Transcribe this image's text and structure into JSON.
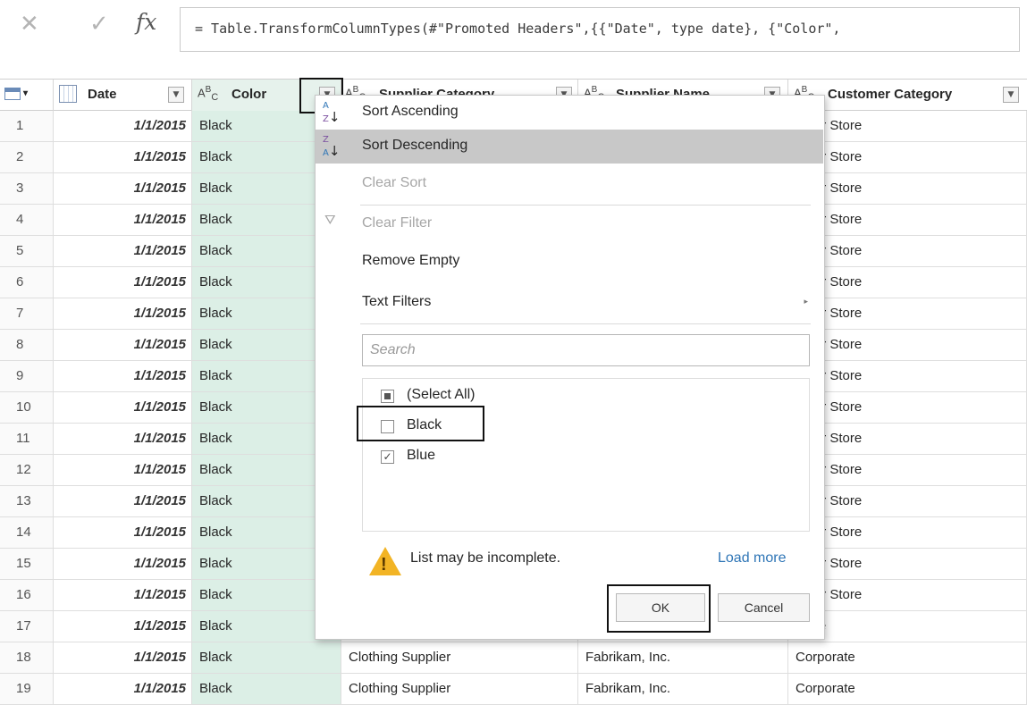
{
  "formula_bar": {
    "cancel_icon": "close-icon",
    "commit_icon": "check-icon",
    "fx_label": "fx",
    "formula": "= Table.TransformColumnTypes(#\"Promoted Headers\",{{\"Date\", type date}, {\"Color\","
  },
  "headers": {
    "date": "Date",
    "color": "Color",
    "supplier_category": "Supplier Category",
    "supplier_name": "Supplier Name",
    "customer_category": "Customer Category",
    "type_text": "A",
    "type_sup": "B",
    "type_sub": "C"
  },
  "rows": [
    {
      "n": "1",
      "date": "1/1/2015",
      "color": "Black",
      "customer_category": "puter Store"
    },
    {
      "n": "2",
      "date": "1/1/2015",
      "color": "Black",
      "customer_category": "puter Store"
    },
    {
      "n": "3",
      "date": "1/1/2015",
      "color": "Black",
      "customer_category": "puter Store"
    },
    {
      "n": "4",
      "date": "1/1/2015",
      "color": "Black",
      "customer_category": "puter Store"
    },
    {
      "n": "5",
      "date": "1/1/2015",
      "color": "Black",
      "customer_category": "puter Store"
    },
    {
      "n": "6",
      "date": "1/1/2015",
      "color": "Black",
      "customer_category": "puter Store"
    },
    {
      "n": "7",
      "date": "1/1/2015",
      "color": "Black",
      "customer_category": "puter Store"
    },
    {
      "n": "8",
      "date": "1/1/2015",
      "color": "Black",
      "customer_category": "puter Store"
    },
    {
      "n": "9",
      "date": "1/1/2015",
      "color": "Black",
      "customer_category": "puter Store"
    },
    {
      "n": "10",
      "date": "1/1/2015",
      "color": "Black",
      "customer_category": "puter Store"
    },
    {
      "n": "11",
      "date": "1/1/2015",
      "color": "Black",
      "customer_category": "puter Store"
    },
    {
      "n": "12",
      "date": "1/1/2015",
      "color": "Black",
      "customer_category": "puter Store"
    },
    {
      "n": "13",
      "date": "1/1/2015",
      "color": "Black",
      "customer_category": "puter Store"
    },
    {
      "n": "14",
      "date": "1/1/2015",
      "color": "Black",
      "customer_category": "puter Store"
    },
    {
      "n": "15",
      "date": "1/1/2015",
      "color": "Black",
      "customer_category": "puter Store"
    },
    {
      "n": "16",
      "date": "1/1/2015",
      "color": "Black",
      "customer_category": "puter Store"
    },
    {
      "n": "17",
      "date": "1/1/2015",
      "color": "Black",
      "customer_category": "orate"
    },
    {
      "n": "18",
      "date": "1/1/2015",
      "color": "Black",
      "supplier_category": "Clothing Supplier",
      "supplier_name": "Fabrikam, Inc.",
      "customer_category": "Corporate"
    },
    {
      "n": "19",
      "date": "1/1/2015",
      "color": "Black",
      "supplier_category": "Clothing Supplier",
      "supplier_name": "Fabrikam, Inc.",
      "customer_category": "Corporate"
    }
  ],
  "filter_menu": {
    "sort_ascending": "Sort Ascending",
    "sort_descending": "Sort Descending",
    "clear_sort": "Clear Sort",
    "clear_filter": "Clear Filter",
    "remove_empty": "Remove Empty",
    "text_filters": "Text Filters",
    "search_placeholder": "Search",
    "items": [
      {
        "label": "(Select All)",
        "state": "partial"
      },
      {
        "label": "Black",
        "state": "unchecked"
      },
      {
        "label": "Blue",
        "state": "checked"
      }
    ],
    "warning": "List may be incomplete.",
    "load_more": "Load more",
    "ok": "OK",
    "cancel": "Cancel"
  },
  "colors": {
    "selected_column": "#dcefe6",
    "menu_hover": "#c8c8c8",
    "link": "#2e75b6",
    "warning": "#f2b425"
  }
}
